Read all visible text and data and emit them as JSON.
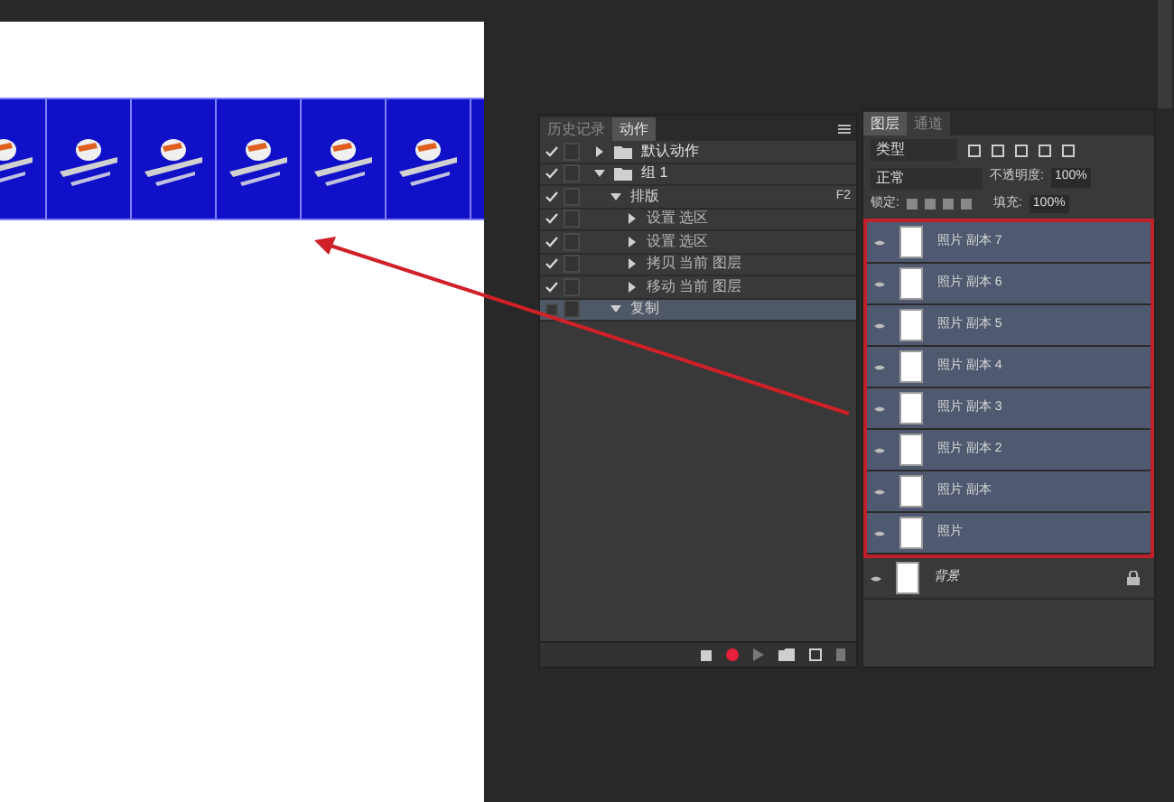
{
  "actions_panel": {
    "tabs": [
      {
        "label": "历史记录",
        "selected": false
      },
      {
        "label": "动作",
        "selected": true
      }
    ],
    "items": [
      {
        "kind": "set",
        "label": "默认动作",
        "checked": true,
        "expanded": false,
        "selected": false
      },
      {
        "kind": "set",
        "label": "组 1",
        "checked": true,
        "expanded": true,
        "selected": false,
        "children": [
          {
            "kind": "action",
            "label": "排版",
            "shortcut": "F2",
            "checked": true,
            "expanded": true,
            "selected": false,
            "children": [
              {
                "kind": "step",
                "label": "设置 选区",
                "checked": true,
                "expanded": false,
                "selected": false
              },
              {
                "kind": "step",
                "label": "设置 选区",
                "checked": true,
                "expanded": false,
                "selected": false
              },
              {
                "kind": "step",
                "label": "拷贝 当前 图层",
                "checked": true,
                "expanded": false,
                "selected": false
              },
              {
                "kind": "step",
                "label": "移动 当前 图层",
                "checked": true,
                "expanded": false,
                "selected": false
              }
            ]
          },
          {
            "kind": "action",
            "label": "复制",
            "checked": false,
            "expanded": true,
            "selected": true
          }
        ]
      }
    ]
  },
  "layers_panel": {
    "tabs": [
      {
        "label": "图层",
        "selected": true
      },
      {
        "label": "通道",
        "selected": false
      }
    ],
    "filter": "类型",
    "blend_mode": "正常",
    "opacity_label": "不透明度:",
    "opacity": "100%",
    "lock_label": "锁定:",
    "fill_label": "填充:",
    "fill": "100%",
    "layers": [
      {
        "name": "照片 副本 7",
        "selected": true,
        "locked": false
      },
      {
        "name": "照片 副本 6",
        "selected": true,
        "locked": false
      },
      {
        "name": "照片 副本 5",
        "selected": true,
        "locked": false
      },
      {
        "name": "照片 副本 4",
        "selected": true,
        "locked": false
      },
      {
        "name": "照片 副本 3",
        "selected": true,
        "locked": false
      },
      {
        "name": "照片 副本 2",
        "selected": true,
        "locked": false
      },
      {
        "name": "照片 副本",
        "selected": true,
        "locked": false
      },
      {
        "name": "照片",
        "selected": true,
        "locked": false
      },
      {
        "name": "背景",
        "selected": false,
        "locked": true
      }
    ]
  }
}
